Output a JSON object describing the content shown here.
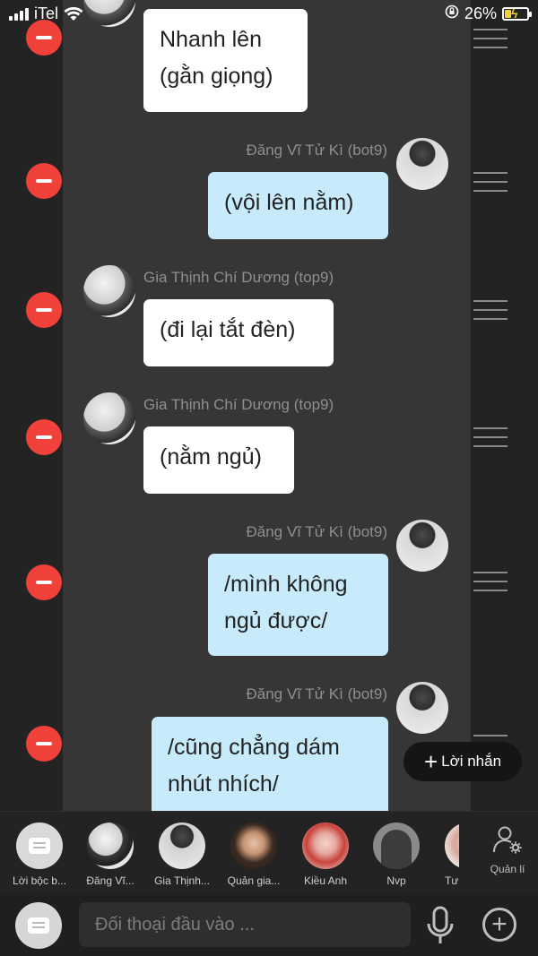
{
  "status_bar": {
    "carrier": "iTel",
    "battery_percent": "26%",
    "battery_level": 0.26
  },
  "messages": [
    {
      "sender": "",
      "text": "Nhanh lên\n(gằn giọng)",
      "side": "left"
    },
    {
      "sender": "Đăng Vĩ Tử Kì (bot9)",
      "text": "(vội lên nằm)",
      "side": "right"
    },
    {
      "sender": "Gia Thịnh Chí Dương (top9)",
      "text": "(đi lại tắt đèn)",
      "side": "left"
    },
    {
      "sender": "Gia Thịnh Chí Dương (top9)",
      "text": "(nằm ngủ)",
      "side": "left"
    },
    {
      "sender": "Đăng Vĩ Tử Kì (bot9)",
      "text": "/mình không\nngủ được/",
      "side": "right"
    },
    {
      "sender": "Đăng Vĩ Tử Kì (bot9)",
      "text": "/cũng chẳng dám\nnhút nhích/",
      "side": "right"
    }
  ],
  "new_message_button": {
    "label": "Lời nhắn"
  },
  "characters": [
    {
      "name": "Lời bộc b..."
    },
    {
      "name": "Đăng Vĩ..."
    },
    {
      "name": "Gia Thịnh..."
    },
    {
      "name": "Quản gia..."
    },
    {
      "name": "Kiều Anh"
    },
    {
      "name": "Nvp"
    },
    {
      "name": "Tư"
    }
  ],
  "manage": {
    "label": "Quản lí"
  },
  "input": {
    "placeholder": "Đối thoại đầu vào ..."
  },
  "colors": {
    "delete": "#f0423a",
    "bubble_self": "#c8ebfb",
    "bubble_other": "#ffffff",
    "chat_bg": "#363636"
  },
  "icons": {
    "delete": "minus-circle-icon",
    "handle": "drag-handle-icon",
    "mic": "microphone-icon",
    "add": "plus-circle-icon",
    "manage": "user-gear-icon",
    "narration": "chat-bubble-icon"
  }
}
